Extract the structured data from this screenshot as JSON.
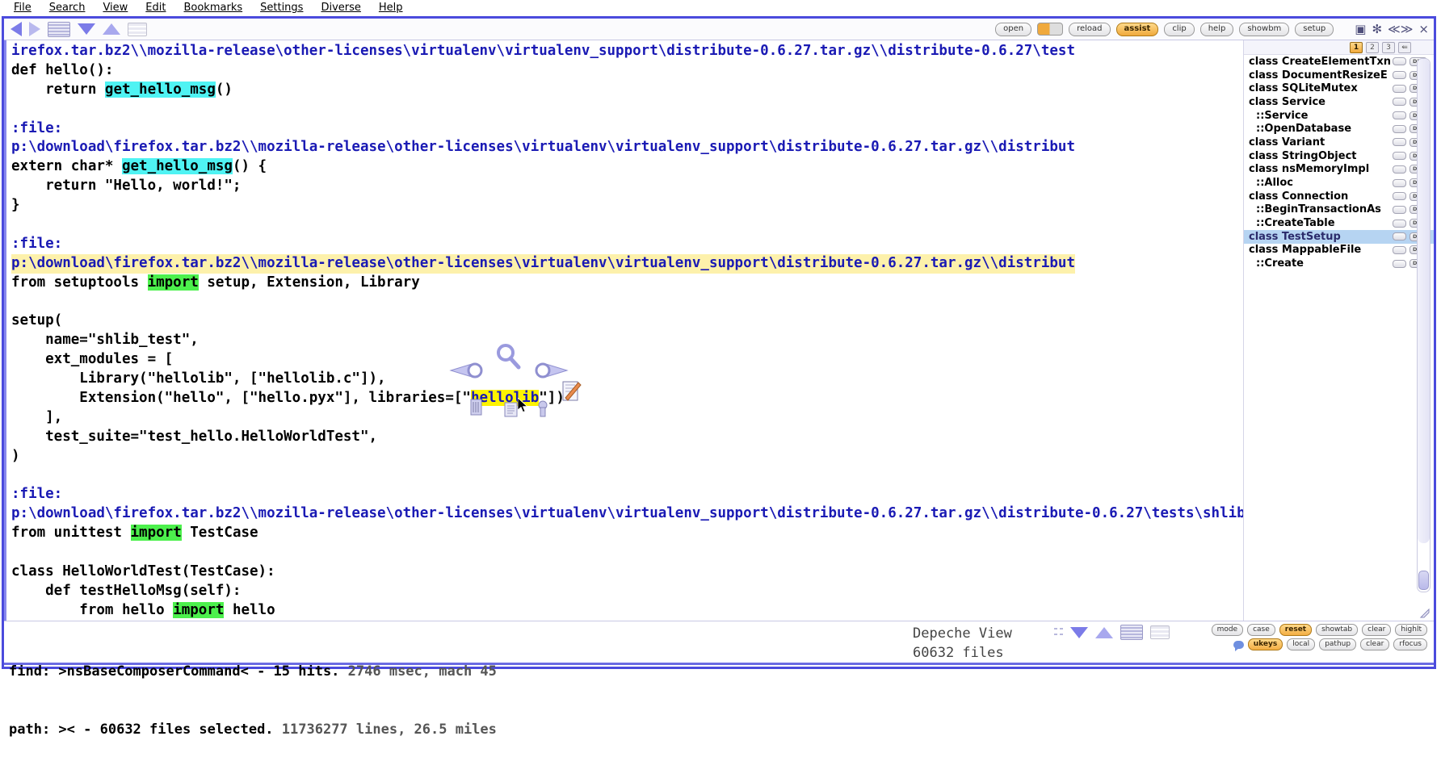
{
  "menubar": {
    "items": [
      "File",
      "Search",
      "View",
      "Edit",
      "Bookmarks",
      "Settings",
      "Diverse",
      "Help"
    ]
  },
  "toolbar": {
    "left_icons": [
      "back-arrow-icon",
      "forward-arrow-icon",
      "stack-icon",
      "down-arrow-icon",
      "up-arrow-icon",
      "list-icon"
    ],
    "buttons": [
      "open",
      "reload",
      "assist",
      "clip",
      "help",
      "showbm",
      "setup"
    ],
    "active_button": "assist",
    "window_glyphs": [
      "▣",
      "✻",
      "≪≫",
      "⨯"
    ]
  },
  "code": {
    "lines": [
      {
        "type": "path",
        "text": "irefox.tar.bz2\\\\mozilla-release\\other-licenses\\virtualenv\\virtualenv_support\\distribute-0.6.27.tar.gz\\\\distribute-0.6.27\\test"
      },
      {
        "type": "code",
        "text": "def hello():"
      },
      {
        "type": "code",
        "text": "    return ",
        "hl": "get_hello_msg",
        "hlclass": "cyan",
        "after": "()"
      },
      {
        "type": "blank",
        "text": ""
      },
      {
        "type": "label",
        "text": ":file:"
      },
      {
        "type": "path",
        "text": "p:\\download\\firefox.tar.bz2\\\\mozilla-release\\other-licenses\\virtualenv\\virtualenv_support\\distribute-0.6.27.tar.gz\\\\distribut"
      },
      {
        "type": "code",
        "text": "extern char* ",
        "hl": "get_hello_msg",
        "hlclass": "cyan",
        "after": "() {"
      },
      {
        "type": "code",
        "text": "    return \"Hello, world!\";"
      },
      {
        "type": "code",
        "text": "}"
      },
      {
        "type": "blank",
        "text": ""
      },
      {
        "type": "label",
        "text": ":file:"
      },
      {
        "type": "pathhl",
        "text": "p:\\download\\firefox.tar.bz2\\\\mozilla-release\\other-licenses\\virtualenv\\virtualenv_support\\distribute-0.6.27.tar.gz\\\\distribut"
      },
      {
        "type": "code",
        "text": "from setuptools ",
        "hl": "import",
        "hlclass": "green",
        "after": " setup, Extension, Library"
      },
      {
        "type": "blank",
        "text": ""
      },
      {
        "type": "code",
        "text": "setup("
      },
      {
        "type": "code",
        "text": "    name=\"shlib_test\","
      },
      {
        "type": "code",
        "text": "    ext_modules = ["
      },
      {
        "type": "code",
        "text": "        Library(\"hellolib\", [\"hellolib.c\"]),"
      },
      {
        "type": "code",
        "text": "        Extension(\"hello\", [\"hello.pyx\"], libraries=[\"",
        "hl": "hellolib",
        "hlclass": "yellow",
        "after": "\"])"
      },
      {
        "type": "code",
        "text": "    ],"
      },
      {
        "type": "code",
        "text": "    test_suite=\"test_hello.HelloWorldTest\","
      },
      {
        "type": "code",
        "text": ")"
      },
      {
        "type": "blank",
        "text": ""
      },
      {
        "type": "label",
        "text": ":file:"
      },
      {
        "type": "path",
        "text": "p:\\download\\firefox.tar.bz2\\\\mozilla-release\\other-licenses\\virtualenv\\virtualenv_support\\distribute-0.6.27.tar.gz\\\\distribute-0.6.27\\tests\\shlib"
      },
      {
        "type": "code",
        "text": "from unittest ",
        "hl": "import",
        "hlclass": "green",
        "after": " TestCase"
      },
      {
        "type": "blank",
        "text": ""
      },
      {
        "type": "code",
        "text": "class HelloWorldTest(TestCase):"
      },
      {
        "type": "code",
        "text": "    def testHelloMsg(self):"
      },
      {
        "type": "code",
        "text": "        from hello ",
        "hl": "import",
        "hlclass": "green",
        "after": " hello"
      }
    ],
    "hover_icons": [
      "arrow-left-icon",
      "magnifier-icon",
      "arrow-right-icon",
      "book-icon",
      "document-icon",
      "pin-icon",
      "edit-note-icon"
    ]
  },
  "right_panel": {
    "tabs": [
      "1",
      "2",
      "3"
    ],
    "selected_tab": "1",
    "extra_tab_icon": "branch-icon",
    "row_button_label": "DEL",
    "items": [
      {
        "label": "class CreateElementTxn",
        "indent": false,
        "selected": false
      },
      {
        "label": "class DocumentResizeE",
        "indent": false,
        "selected": false
      },
      {
        "label": "class SQLiteMutex",
        "indent": false,
        "selected": false
      },
      {
        "label": "class Service",
        "indent": false,
        "selected": false
      },
      {
        "label": "::Service",
        "indent": true,
        "selected": false
      },
      {
        "label": "::OpenDatabase",
        "indent": true,
        "selected": false
      },
      {
        "label": "class Variant",
        "indent": false,
        "selected": false
      },
      {
        "label": "class StringObject",
        "indent": false,
        "selected": false
      },
      {
        "label": "class nsMemoryImpl",
        "indent": false,
        "selected": false
      },
      {
        "label": "::Alloc",
        "indent": true,
        "selected": false
      },
      {
        "label": "class Connection",
        "indent": false,
        "selected": false
      },
      {
        "label": "::BeginTransactionAs",
        "indent": true,
        "selected": false
      },
      {
        "label": "::CreateTable",
        "indent": true,
        "selected": false
      },
      {
        "label": "class TestSetup",
        "indent": false,
        "selected": true
      },
      {
        "label": "class MappableFile",
        "indent": false,
        "selected": false
      },
      {
        "label": "::Create",
        "indent": true,
        "selected": false
      }
    ]
  },
  "status": {
    "find_label": "find: ",
    "find_query": ">nsBaseComposerCommand<",
    "find_result": " - 15 hits.",
    "find_timing": " 2746 msec, mach 45",
    "path_label": "path: ",
    "path_query": "><",
    "path_result": " - 60632 files selected.",
    "path_stats": " 11736277 lines, 26.5 miles",
    "view_name": "Depeche View",
    "view_count": "60632 files",
    "buttons_row1": [
      "mode",
      "case",
      "reset",
      "showtab",
      "clear",
      "highlt"
    ],
    "buttons_row2": [
      "ukeys",
      "local",
      "pathup",
      "clear",
      "rfocus"
    ],
    "active_buttons": [
      "reset",
      "ukeys"
    ],
    "icons": [
      "dots-icon",
      "down-arrow-icon",
      "up-arrow-icon",
      "stack-icon",
      "list-icon",
      "speech-bubble-icon"
    ]
  },
  "colors": {
    "frame": "#4b4bdd",
    "accent_orange": "#f0a93c",
    "path_blue": "#1a1ab4",
    "highlight_cyan": "#4ff3f3",
    "highlight_green": "#4cf04c",
    "highlight_yellow": "#fdf300",
    "select_blue": "#b6d4f2",
    "path_band": "#fdf1ab"
  }
}
